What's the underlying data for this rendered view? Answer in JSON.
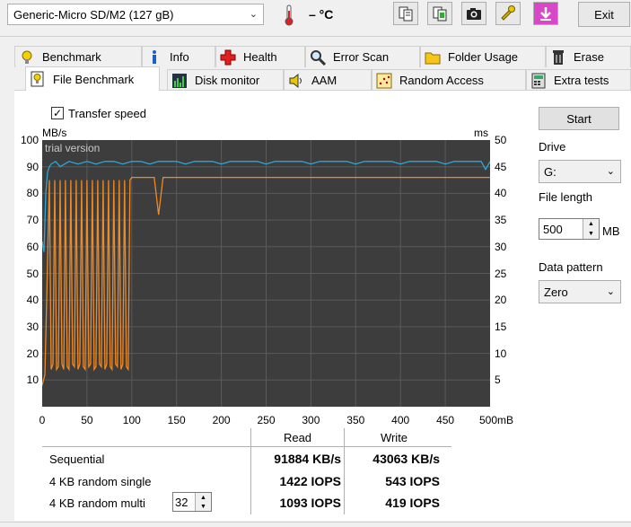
{
  "toolbar": {
    "drive_select": "Generic-Micro SD/M2 (127 gB)",
    "temperature": "– °C",
    "exit_label": "Exit"
  },
  "tabs_row1": [
    {
      "label": "Benchmark",
      "icon": "lightbulb-icon"
    },
    {
      "label": "Info",
      "icon": "info-icon"
    },
    {
      "label": "Health",
      "icon": "red-cross-icon"
    },
    {
      "label": "Error Scan",
      "icon": "magnifier-icon"
    },
    {
      "label": "Folder Usage",
      "icon": "folder-icon"
    },
    {
      "label": "Erase",
      "icon": "trash-icon"
    }
  ],
  "tabs_row2": [
    {
      "label": "File Benchmark",
      "icon": "file-benchmark-icon",
      "active": true
    },
    {
      "label": "Disk monitor",
      "icon": "chart-bars-icon"
    },
    {
      "label": "AAM",
      "icon": "speaker-icon"
    },
    {
      "label": "Random Access",
      "icon": "scatter-icon"
    },
    {
      "label": "Extra tests",
      "icon": "calculator-icon"
    }
  ],
  "options": {
    "transfer_speed_label": "Transfer speed",
    "transfer_speed_checked": true,
    "checkmark": "✓"
  },
  "chart": {
    "left_unit": "MB/s",
    "right_unit": "ms",
    "watermark": "trial version",
    "y_left_ticks": [
      "100",
      "90",
      "80",
      "70",
      "60",
      "50",
      "40",
      "30",
      "20",
      "10"
    ],
    "y_right_ticks": [
      "50",
      "45",
      "40",
      "35",
      "30",
      "25",
      "20",
      "15",
      "10",
      "5"
    ],
    "x_ticks": [
      "0",
      "50",
      "100",
      "150",
      "200",
      "250",
      "300",
      "350",
      "400",
      "450",
      "500mB"
    ]
  },
  "chart_data": {
    "type": "line",
    "xlabel": "",
    "ylabel": "MB/s",
    "y2label": "ms",
    "xlim": [
      0,
      500
    ],
    "ylim": [
      0,
      100
    ],
    "y2lim": [
      0,
      50
    ],
    "grid": true,
    "series": [
      {
        "color": "#2da8d8",
        "x": [
          0,
          2,
          4,
          6,
          8,
          10,
          15,
          20,
          30,
          40,
          50,
          60,
          70,
          80,
          90,
          100,
          110,
          120,
          130,
          140,
          150,
          160,
          170,
          180,
          190,
          200,
          210,
          220,
          230,
          240,
          250,
          260,
          270,
          280,
          290,
          300,
          310,
          320,
          330,
          340,
          350,
          360,
          370,
          380,
          390,
          400,
          410,
          420,
          430,
          440,
          450,
          460,
          470,
          480,
          490,
          495,
          500
        ],
        "values": [
          62,
          58,
          80,
          88,
          90,
          91,
          92,
          90,
          92,
          91,
          92,
          91,
          92,
          92,
          91,
          92,
          92,
          91,
          92,
          92,
          92,
          91,
          92,
          92,
          92,
          91,
          92,
          92,
          92,
          92,
          91,
          92,
          92,
          92,
          92,
          91,
          92,
          92,
          92,
          92,
          91,
          92,
          92,
          92,
          92,
          91,
          92,
          92,
          92,
          92,
          91,
          92,
          92,
          92,
          92,
          89,
          92
        ]
      },
      {
        "color": "#f08a24",
        "x": [
          0,
          3,
          5,
          8,
          10,
          12,
          14,
          16,
          18,
          20,
          22,
          24,
          26,
          28,
          30,
          32,
          34,
          36,
          38,
          40,
          42,
          44,
          46,
          48,
          50,
          52,
          54,
          56,
          58,
          60,
          62,
          64,
          66,
          68,
          70,
          72,
          74,
          76,
          78,
          80,
          82,
          84,
          86,
          88,
          90,
          92,
          94,
          96,
          98,
          100,
          105,
          110,
          115,
          120,
          125,
          130,
          135,
          140,
          145,
          150,
          160,
          170,
          180,
          190,
          200,
          210,
          220,
          230,
          240,
          250,
          260,
          270,
          280,
          290,
          300,
          310,
          320,
          330,
          340,
          350,
          360,
          370,
          380,
          390,
          400,
          410,
          420,
          430,
          440,
          450,
          460,
          470,
          480,
          490,
          500
        ],
        "values": [
          8,
          12,
          40,
          85,
          14,
          16,
          85,
          14,
          15,
          85,
          16,
          14,
          85,
          15,
          14,
          85,
          16,
          15,
          85,
          14,
          16,
          85,
          15,
          14,
          85,
          15,
          16,
          85,
          14,
          15,
          85,
          16,
          15,
          85,
          14,
          16,
          85,
          15,
          14,
          85,
          16,
          15,
          85,
          14,
          16,
          85,
          15,
          14,
          85,
          86,
          86,
          86,
          86,
          86,
          86,
          72,
          86,
          86,
          86,
          86,
          86,
          86,
          86,
          86,
          86,
          86,
          86,
          86,
          86,
          86,
          86,
          86,
          86,
          86,
          86,
          86,
          86,
          86,
          86,
          86,
          86,
          86,
          86,
          86,
          86,
          86,
          86,
          86,
          86,
          86,
          86,
          86,
          86,
          86,
          86
        ]
      }
    ]
  },
  "results": {
    "col_read": "Read",
    "col_write": "Write",
    "rows": [
      {
        "label": "Sequential",
        "read": "91884 KB/s",
        "write": "43063 KB/s"
      },
      {
        "label": "4 KB random single",
        "read": "1422 IOPS",
        "write": "543 IOPS"
      },
      {
        "label": "4 KB random multi",
        "read": "1093 IOPS",
        "write": "419 IOPS"
      }
    ],
    "queue_depth": "32"
  },
  "side_panel": {
    "start_label": "Start",
    "drive_label": "Drive",
    "drive_value": "G:",
    "file_length_label": "File length",
    "file_length_value": "500",
    "file_length_unit": "MB",
    "data_pattern_label": "Data pattern",
    "data_pattern_value": "Zero"
  }
}
